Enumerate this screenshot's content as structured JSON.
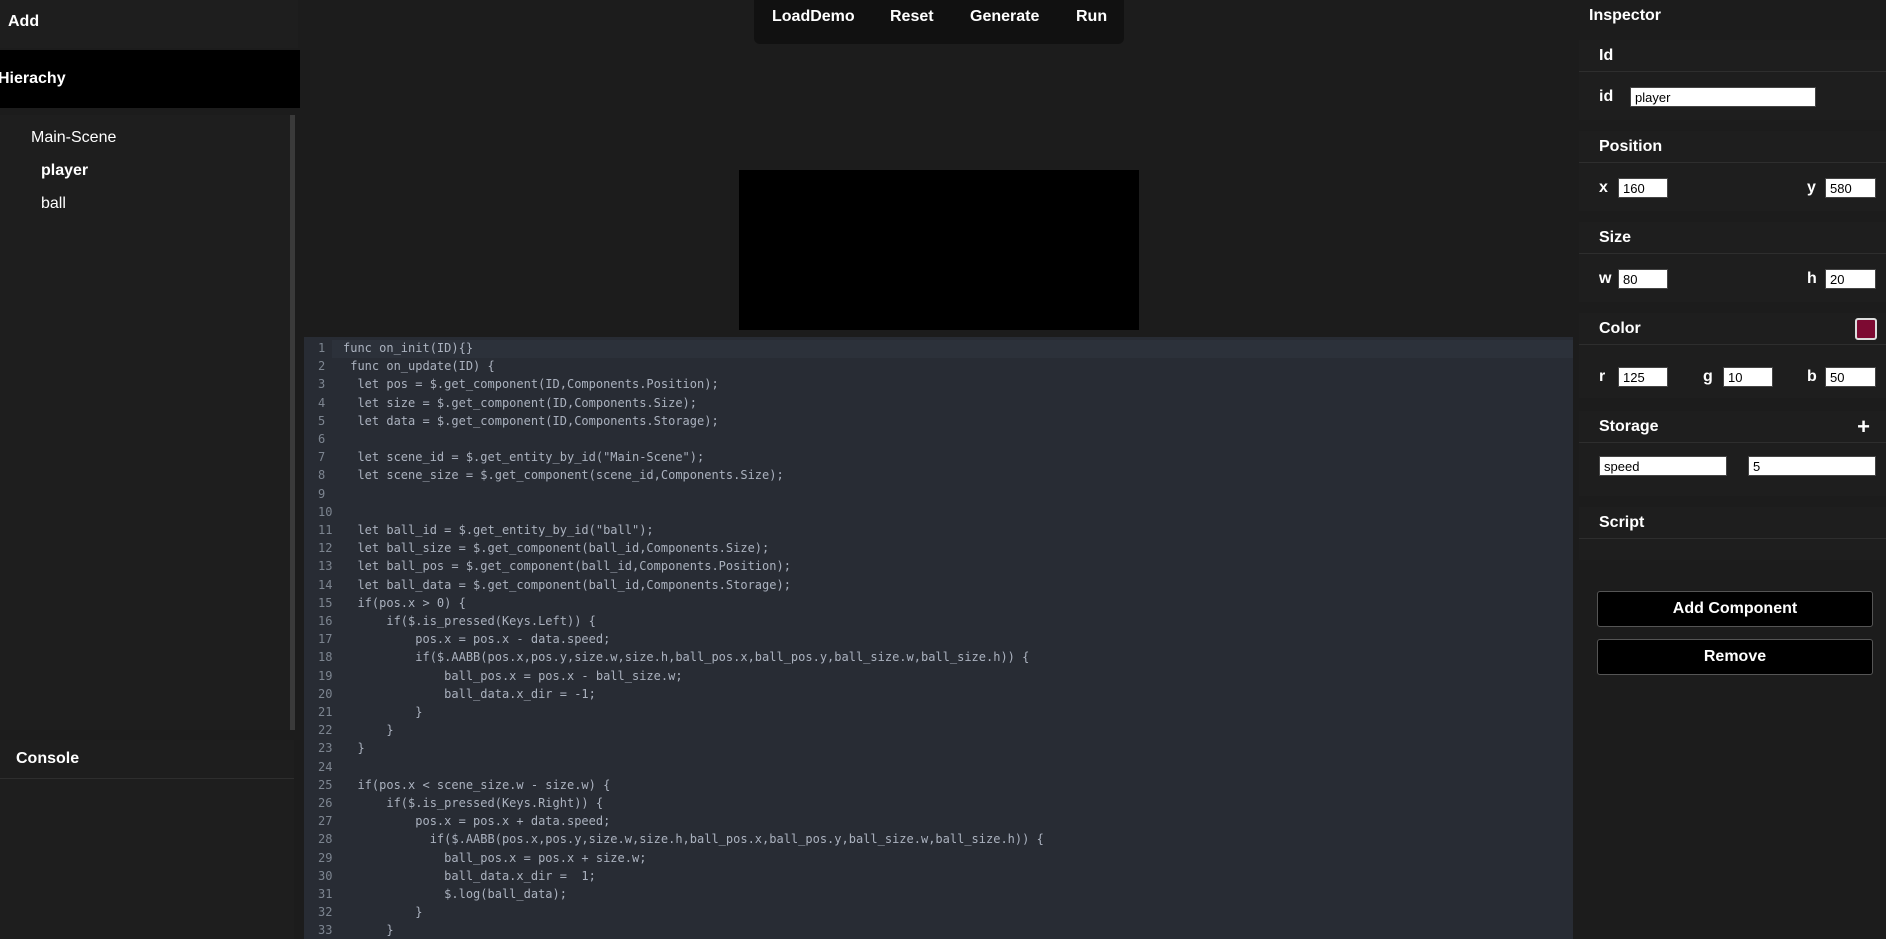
{
  "left": {
    "add_title": "Add",
    "hierarchy_title": "Hierachy",
    "tree": [
      "Main-Scene",
      "player",
      "ball"
    ],
    "console_title": "Console"
  },
  "toolbar": {
    "load_demo": "LoadDemo",
    "reset": "Reset",
    "generate": "Generate",
    "run": "Run"
  },
  "editor": {
    "lines": [
      "func on_init(ID){}",
      " func on_update(ID) {",
      "  let pos = $.get_component(ID,Components.Position);",
      "  let size = $.get_component(ID,Components.Size);",
      "  let data = $.get_component(ID,Components.Storage);",
      "",
      "  let scene_id = $.get_entity_by_id(\"Main-Scene\");",
      "  let scene_size = $.get_component(scene_id,Components.Size);",
      "",
      "",
      "  let ball_id = $.get_entity_by_id(\"ball\");",
      "  let ball_size = $.get_component(ball_id,Components.Size);",
      "  let ball_pos = $.get_component(ball_id,Components.Position);",
      "  let ball_data = $.get_component(ball_id,Components.Storage);",
      "  if(pos.x > 0) {",
      "      if($.is_pressed(Keys.Left)) {",
      "          pos.x = pos.x - data.speed;",
      "          if($.AABB(pos.x,pos.y,size.w,size.h,ball_pos.x,ball_pos.y,ball_size.w,ball_size.h)) {",
      "              ball_pos.x = pos.x - ball_size.w;",
      "              ball_data.x_dir = -1;",
      "          }",
      "      }",
      "  }",
      "",
      "  if(pos.x < scene_size.w - size.w) {",
      "      if($.is_pressed(Keys.Right)) {",
      "          pos.x = pos.x + data.speed;",
      "            if($.AABB(pos.x,pos.y,size.w,size.h,ball_pos.x,ball_pos.y,ball_size.w,ball_size.h)) {",
      "              ball_pos.x = pos.x + size.w;",
      "              ball_data.x_dir =  1;",
      "              $.log(ball_data);",
      "          }",
      "      }"
    ]
  },
  "inspector": {
    "title": "Inspector",
    "id_section": {
      "title": "Id",
      "label": "id",
      "value": "player"
    },
    "position": {
      "title": "Position",
      "x_label": "x",
      "x": "160",
      "y_label": "y",
      "y": "580"
    },
    "size": {
      "title": "Size",
      "w_label": "w",
      "w": "80",
      "h_label": "h",
      "h": "20"
    },
    "color": {
      "title": "Color",
      "r_label": "r",
      "r": "125",
      "g_label": "g",
      "g": "10",
      "b_label": "b",
      "b": "50",
      "swatch": "#7d0a32"
    },
    "storage": {
      "title": "Storage",
      "add": "+",
      "key": "speed",
      "value": "5"
    },
    "script": {
      "title": "Script"
    },
    "add_component": "Add Component",
    "remove": "Remove"
  }
}
